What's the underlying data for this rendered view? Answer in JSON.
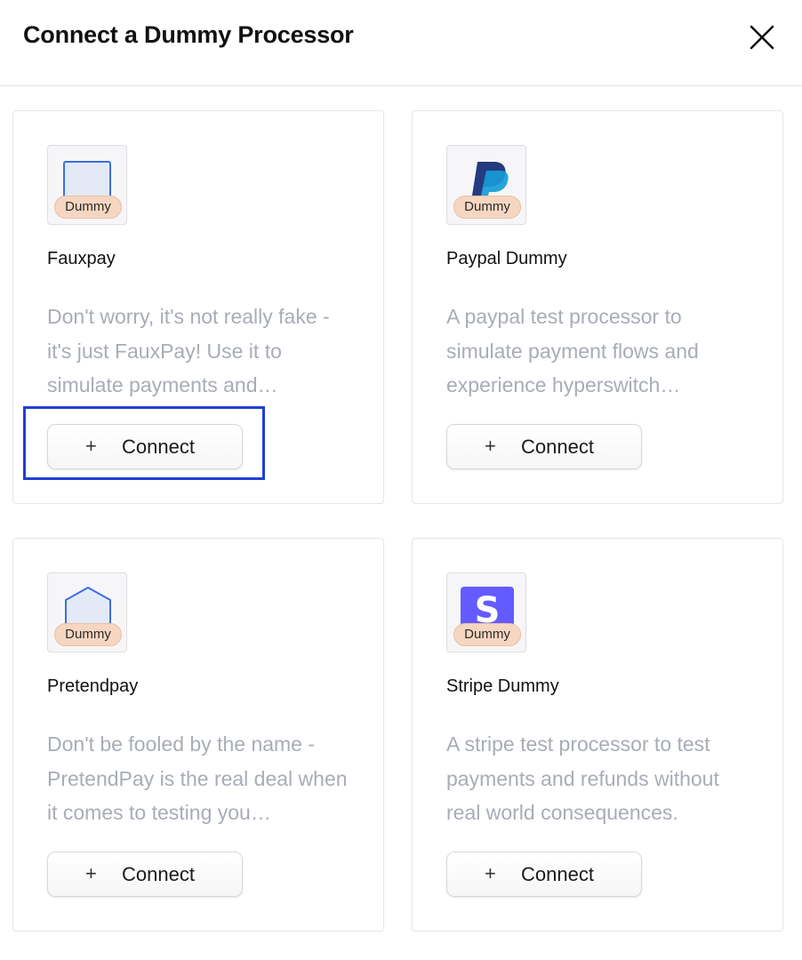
{
  "dialog": {
    "title": "Connect a Dummy Processor",
    "close_icon": "close-icon"
  },
  "processors": [
    {
      "name": "Fauxpay",
      "badge": "Dummy",
      "logo_icon": "fauxpay-logo-icon",
      "description": "Don't worry, it's not really fake - it's just FauxPay! Use it to simulate payments and…",
      "connect_label": "Connect",
      "plus_glyph": "+",
      "highlighted": true
    },
    {
      "name": "Paypal Dummy",
      "badge": "Dummy",
      "logo_icon": "paypal-logo-icon",
      "description": "A paypal test processor to simulate payment flows and experience hyperswitch…",
      "connect_label": "Connect",
      "plus_glyph": "+"
    },
    {
      "name": "Pretendpay",
      "badge": "Dummy",
      "logo_icon": "pretendpay-logo-icon",
      "description": "Don't be fooled by the name - PretendPay is the real deal when it comes to testing you…",
      "connect_label": "Connect",
      "plus_glyph": "+"
    },
    {
      "name": "Stripe Dummy",
      "badge": "Dummy",
      "logo_icon": "stripe-logo-icon",
      "description": "A stripe test processor to test payments and refunds without real world consequences.",
      "connect_label": "Connect",
      "plus_glyph": "+"
    }
  ],
  "colors": {
    "highlight_border": "#1f3fd6",
    "badge_bg": "#f6d6c1",
    "description_text": "#a8adb5",
    "stripe_purple": "#635bff",
    "paypal_dark": "#253b80",
    "paypal_light": "#179bd7"
  }
}
